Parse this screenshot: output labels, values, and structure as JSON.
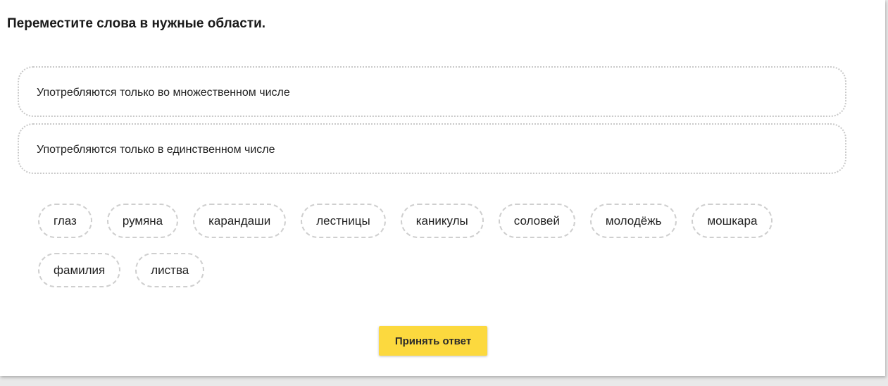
{
  "task": {
    "title": "Переместите слова в нужные области."
  },
  "drop_zones": [
    {
      "label": "Употребляются только во множественном числе"
    },
    {
      "label": "Употребляются только в единственном числе"
    }
  ],
  "words": [
    "глаз",
    "румяна",
    "карандаши",
    "лестницы",
    "каникулы",
    "соловей",
    "молодёжь",
    "мошкара",
    "фамилия",
    "листва"
  ],
  "submit": {
    "label": "Принять ответ"
  },
  "colors": {
    "accent": "#fcd93e",
    "border": "#cfcfcf"
  }
}
